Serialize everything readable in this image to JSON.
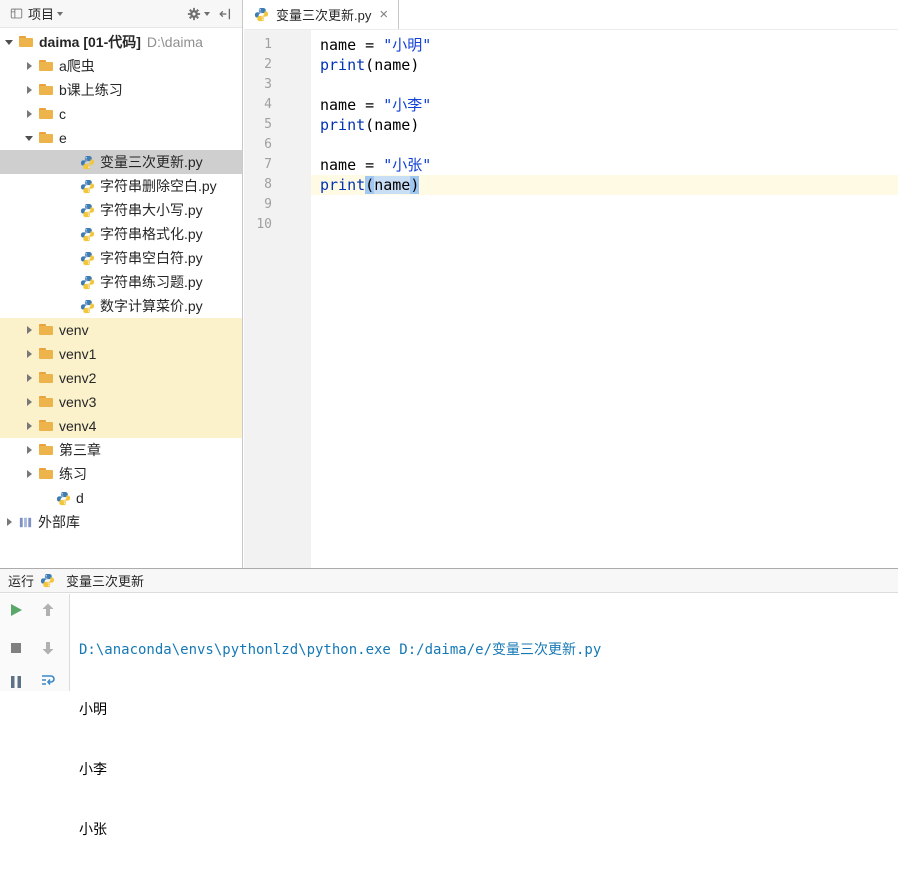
{
  "project_panel": {
    "header": {
      "title": "项目",
      "icons": [
        "project-view-icon",
        "dropdown-caret",
        "gear-icon",
        "hide-panel-icon"
      ]
    },
    "root": {
      "name": "daima [01-代码]",
      "path": "D:\\daima"
    },
    "items": [
      {
        "label": "a爬虫",
        "type": "folder"
      },
      {
        "label": "b课上练习",
        "type": "folder"
      },
      {
        "label": "c",
        "type": "folder"
      },
      {
        "label": "e",
        "type": "folder",
        "expanded": true
      },
      {
        "label": "变量三次更新.py",
        "type": "python-file",
        "selected": true
      },
      {
        "label": "字符串删除空白.py",
        "type": "python-file"
      },
      {
        "label": "字符串大小写.py",
        "type": "python-file"
      },
      {
        "label": "字符串格式化.py",
        "type": "python-file"
      },
      {
        "label": "字符串空白符.py",
        "type": "python-file"
      },
      {
        "label": "字符串练习题.py",
        "type": "python-file"
      },
      {
        "label": "数字计算菜价.py",
        "type": "python-file"
      },
      {
        "label": "venv",
        "type": "folder"
      },
      {
        "label": "venv1",
        "type": "folder"
      },
      {
        "label": "venv2",
        "type": "folder"
      },
      {
        "label": "venv3",
        "type": "folder"
      },
      {
        "label": "venv4",
        "type": "folder"
      },
      {
        "label": "第三章",
        "type": "folder"
      },
      {
        "label": "练习",
        "type": "folder"
      },
      {
        "label": "d",
        "type": "python-file"
      },
      {
        "label": "外部库",
        "type": "library"
      }
    ]
  },
  "editor": {
    "tab": {
      "title": "变量三次更新.py",
      "close_glyph": "×"
    },
    "line_numbers": [
      "1",
      "2",
      "3",
      "4",
      "5",
      "6",
      "7",
      "8",
      "9",
      "10"
    ],
    "code": {
      "l1": {
        "var": "name",
        "op": " = ",
        "str": "\"小明\""
      },
      "l2": {
        "kw": "print",
        "open": "(",
        "arg": "name",
        "close": ")"
      },
      "l4": {
        "var": "name",
        "op": " = ",
        "str": "\"小李\""
      },
      "l5": {
        "kw": "print",
        "open": "(",
        "arg": "name",
        "close": ")"
      },
      "l7": {
        "var": "name",
        "op": " = ",
        "str": "\"小张\""
      },
      "l8": {
        "kw": "print",
        "open": "(",
        "arg": "name",
        "close": ")"
      }
    }
  },
  "run_panel": {
    "title": "运行",
    "process_name": "变量三次更新",
    "toolbar_icons": [
      "run-icon",
      "up-arrow-icon",
      "stop-icon",
      "down-arrow-icon",
      "pause-icon",
      "soft-wrap-icon"
    ],
    "console_lines": [
      {
        "text": "D:\\anaconda\\envs\\pythonlzd\\python.exe D:/daima/e/变量三次更新.py",
        "kind": "command"
      },
      {
        "text": "小明",
        "kind": "stdout"
      },
      {
        "text": "小李",
        "kind": "stdout"
      },
      {
        "text": "小张",
        "kind": "stdout"
      }
    ]
  },
  "colors": {
    "keyword": "#0033B3",
    "string": "#1141D6",
    "caret_line": "#FFFAE3",
    "brace_match": "#9FC7F0",
    "selection_inactive": "#CFCFCF",
    "unversioned_row": "#FBF2CC",
    "console_command": "#1679B6",
    "run_green": "#59A869"
  }
}
